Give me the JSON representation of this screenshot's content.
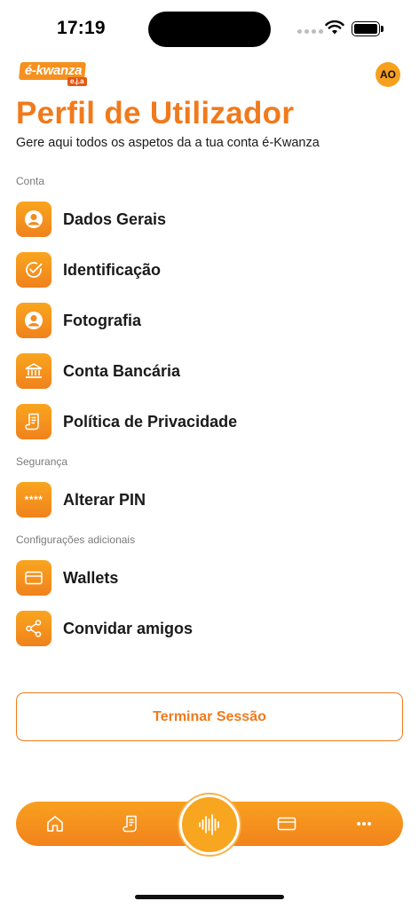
{
  "status_bar": {
    "time": "17:19"
  },
  "header": {
    "logo_text": "é-kwanza",
    "logo_sub": "e.j.a",
    "avatar_initials": "AO",
    "title": "Perfil de Utilizador",
    "subtitle": "Gere aqui todos os aspetos da a tua conta é-Kwanza"
  },
  "sections": {
    "conta": "Conta",
    "seguranca": "Segurança",
    "configuracoes": "Configurações adicionais"
  },
  "menu": {
    "dados_gerais": {
      "label": "Dados Gerais",
      "icon": "user-circle-icon"
    },
    "identificacao": {
      "label": "Identificação",
      "icon": "check-badge-icon"
    },
    "fotografia": {
      "label": "Fotografia",
      "icon": "user-circle-icon"
    },
    "conta_bancaria": {
      "label": "Conta Bancária",
      "icon": "bank-icon"
    },
    "politica": {
      "label": "Política de Privacidade",
      "icon": "document-icon"
    },
    "alterar_pin": {
      "label": "Alterar PIN",
      "icon_text": "****",
      "icon": "pin-icon"
    },
    "wallets": {
      "label": "Wallets",
      "icon": "card-icon"
    },
    "convidar": {
      "label": "Convidar amigos",
      "icon": "share-icon"
    }
  },
  "logout": {
    "label": "Terminar Sessão"
  },
  "bottom_nav": {
    "items": [
      "home-icon",
      "receipt-icon",
      "voice-wave-icon",
      "card-icon",
      "more-icon"
    ]
  },
  "colors": {
    "accent": "#f07a1c",
    "accent_light": "#f9a51f"
  }
}
